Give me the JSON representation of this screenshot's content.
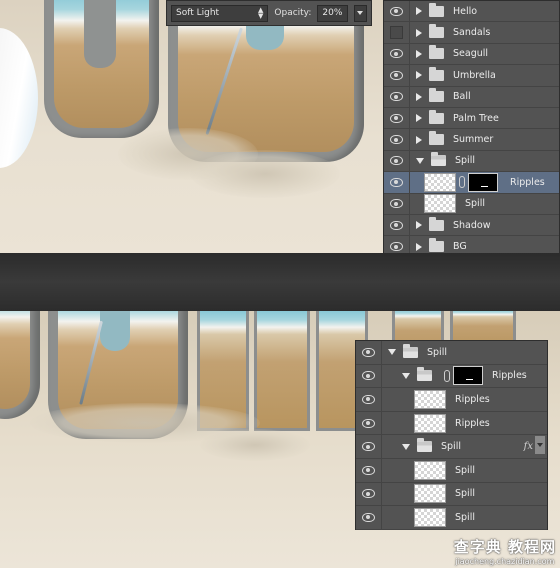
{
  "options_bar": {
    "blend_mode": "Soft Light",
    "opacity_label": "Opacity:",
    "opacity_value": "20%"
  },
  "top_layers": [
    {
      "name": "Hello",
      "visible": true,
      "type": "group"
    },
    {
      "name": "Sandals",
      "visible": false,
      "type": "group"
    },
    {
      "name": "Seagull",
      "visible": true,
      "type": "group"
    },
    {
      "name": "Umbrella",
      "visible": true,
      "type": "group"
    },
    {
      "name": "Ball",
      "visible": true,
      "type": "group"
    },
    {
      "name": "Palm Tree",
      "visible": true,
      "type": "group"
    },
    {
      "name": "Summer",
      "visible": true,
      "type": "group"
    },
    {
      "name": "Spill",
      "visible": true,
      "type": "group-open"
    },
    {
      "name": "Ripples",
      "visible": true,
      "type": "masked-layer",
      "selected": true
    },
    {
      "name": "Spill",
      "visible": true,
      "type": "layer"
    },
    {
      "name": "Shadow",
      "visible": true,
      "type": "group"
    },
    {
      "name": "BG",
      "visible": true,
      "type": "group"
    }
  ],
  "bottom_layers": [
    {
      "name": "Spill",
      "visible": true,
      "type": "group-open"
    },
    {
      "name": "Ripples",
      "visible": true,
      "type": "group-open-mask"
    },
    {
      "name": "Ripples",
      "visible": true,
      "type": "layer"
    },
    {
      "name": "Ripples",
      "visible": true,
      "type": "layer"
    },
    {
      "name": "Spill",
      "visible": true,
      "type": "group-open-fx",
      "fx": "fx"
    },
    {
      "name": "Spill",
      "visible": true,
      "type": "layer"
    },
    {
      "name": "Spill",
      "visible": true,
      "type": "layer"
    },
    {
      "name": "Spill",
      "visible": true,
      "type": "layer"
    }
  ],
  "watermark": {
    "title": "查字典 教程网",
    "url": "jiaocheng.chazidian.com"
  },
  "colors": {
    "panel_bg": "#535353",
    "selected_row": "#5f6f86",
    "divider": "#333333"
  }
}
